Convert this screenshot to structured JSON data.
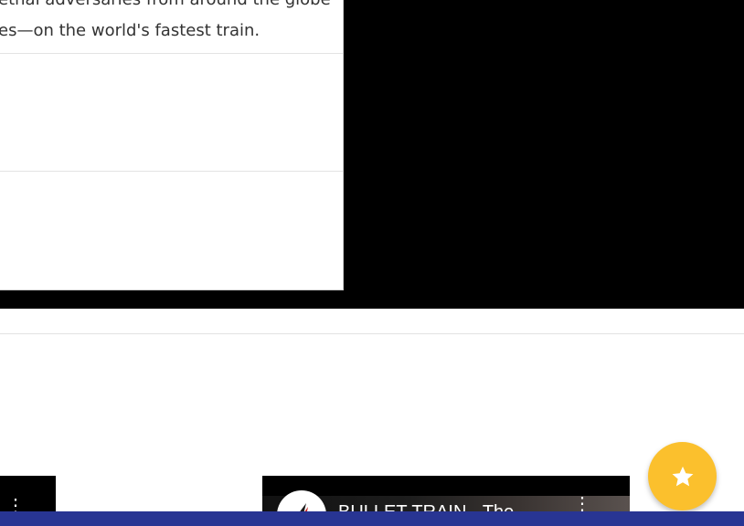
{
  "card": {
    "description_line1": "ethal adversaries from around the globe",
    "description_line2": "es—on the world's fastest train."
  },
  "video": {
    "title": "BULLET TRAIN - The",
    "menu_glyph": "⋮"
  },
  "left_thumb": {
    "menu_glyph": "⋮"
  },
  "fab": {
    "icon": "star-icon"
  },
  "colors": {
    "fab": "#fbc02d",
    "bottom_bar": "#283593",
    "video_bg": "#000000"
  }
}
